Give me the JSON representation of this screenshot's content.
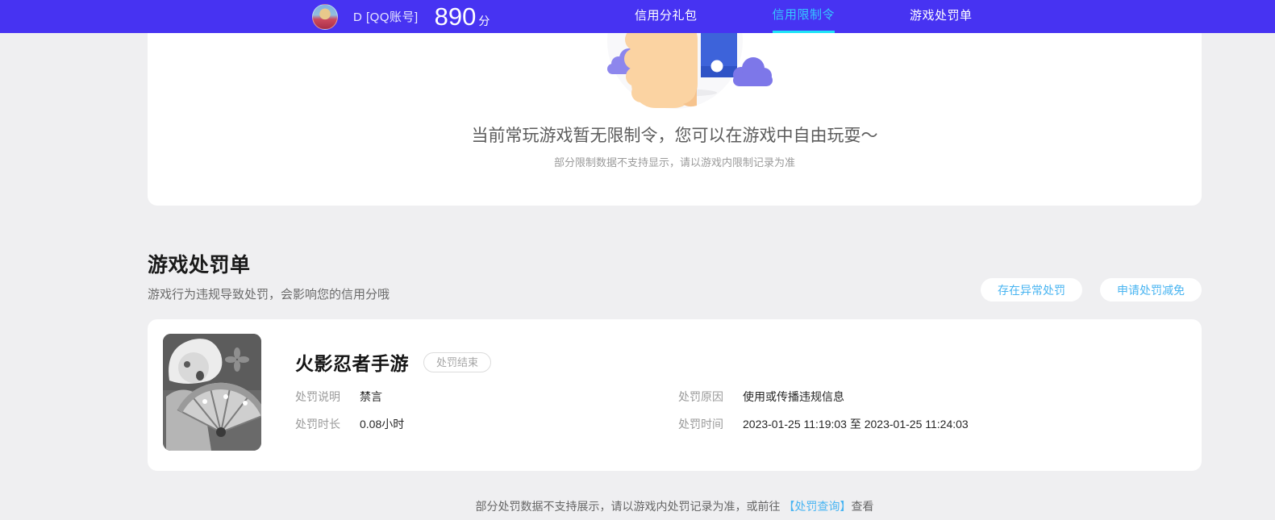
{
  "header": {
    "user": {
      "name": "D [QQ账号]",
      "score": "890",
      "score_unit": "分"
    },
    "nav": [
      {
        "label": "信用分礼包",
        "active": false
      },
      {
        "label": "信用限制令",
        "active": true
      },
      {
        "label": "游戏处罚单",
        "active": false
      }
    ]
  },
  "restriction_card": {
    "main_text": "当前常玩游戏暂无限制令，您可以在游戏中自由玩耍～",
    "sub_text": "部分限制数据不支持显示，请以游戏内限制记录为准"
  },
  "penalty_section": {
    "title": "游戏处罚单",
    "subtitle": "游戏行为违规导致处罚，会影响您的信用分哦",
    "abnormal_button": "存在异常处罚",
    "reduction_button": "申请处罚减免"
  },
  "penalty_card": {
    "game_name": "火影忍者手游",
    "status_badge": "处罚结束",
    "fields": [
      {
        "label": "处罚说明",
        "value": "禁言"
      },
      {
        "label": "处罚原因",
        "value": "使用或传播违规信息"
      },
      {
        "label": "处罚时长",
        "value": "0.08小时"
      },
      {
        "label": "处罚时间",
        "value": "2023-01-25 11:19:03 至 2023-01-25 11:24:03"
      }
    ]
  },
  "footer": {
    "text_before": "部分处罚数据不支持展示，请以游戏内处罚记录为准，或前往 ",
    "link": "【处罚查询】",
    "text_after": "查看"
  },
  "colors": {
    "header_bg": "#4733f2",
    "active_tab": "#35c9ff",
    "tab_underline": "#1ee4f7",
    "accent_blue": "#48b4f1",
    "page_bg": "#efeff1"
  }
}
